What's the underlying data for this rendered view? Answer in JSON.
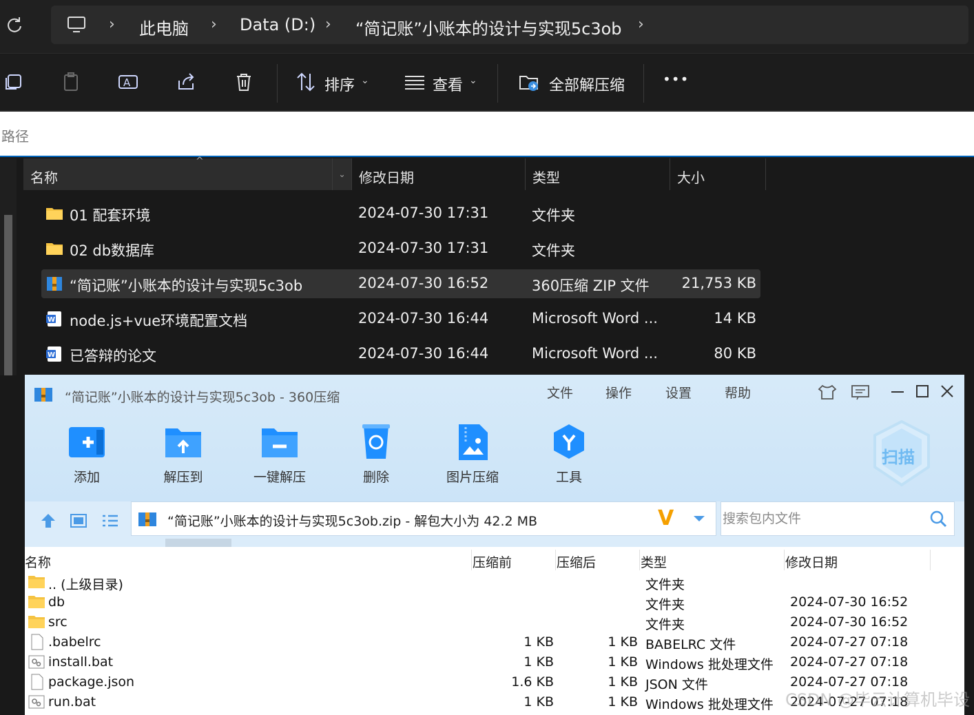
{
  "explorer": {
    "breadcrumbs": [
      "此电脑",
      "Data (D:)",
      "“简记账”小账本的设计与实现5c3ob"
    ],
    "toolbar": {
      "sort_label": "排序",
      "view_label": "查看",
      "extract_all_label": "全部解压缩",
      "more_label": "•••"
    },
    "path_placeholder": "路径",
    "columns": {
      "name": "名称",
      "modified": "修改日期",
      "type": "类型",
      "size": "大小"
    },
    "files": [
      {
        "name": "01 配套环境",
        "modified": "2024-07-30 17:31",
        "type": "文件夹",
        "size": "",
        "icon": "folder-icon"
      },
      {
        "name": "02 db数据库",
        "modified": "2024-07-30 17:31",
        "type": "文件夹",
        "size": "",
        "icon": "folder-icon"
      },
      {
        "name": "“简记账”小账本的设计与实现5c3ob",
        "modified": "2024-07-30 16:52",
        "type": "360压缩 ZIP 文件",
        "size": "21,753 KB",
        "icon": "zip-archive-icon",
        "selected": true
      },
      {
        "name": "node.js+vue环境配置文档",
        "modified": "2024-07-30 16:44",
        "type": "Microsoft Word ...",
        "size": "14 KB",
        "icon": "word-doc-icon"
      },
      {
        "name": "已答辩的论文",
        "modified": "2024-07-30 16:44",
        "type": "Microsoft Word ...",
        "size": "80 KB",
        "icon": "word-doc-icon"
      }
    ]
  },
  "zip": {
    "title": "“简记账”小账本的设计与实现5c3ob - 360压缩",
    "menu": [
      "文件",
      "操作",
      "设置",
      "帮助"
    ],
    "tools": [
      {
        "label": "添加",
        "icon": "add-icon"
      },
      {
        "label": "解压到",
        "icon": "extract-to-icon"
      },
      {
        "label": "一键解压",
        "icon": "one-click-extract-icon"
      },
      {
        "label": "删除",
        "icon": "delete-icon"
      },
      {
        "label": "图片压缩",
        "icon": "image-compress-icon"
      },
      {
        "label": "工具",
        "icon": "tools-icon"
      }
    ],
    "scan_label": "扫描",
    "path_text": "“简记账”小账本的设计与实现5c3ob.zip - 解包大小为 42.2 MB",
    "search_placeholder": "搜索包内文件",
    "columns": {
      "name": "名称",
      "before": "压缩前",
      "after": "压缩后",
      "type": "类型",
      "modified": "修改日期"
    },
    "entries": [
      {
        "name": ".. (上级目录)",
        "before": "",
        "after": "",
        "type": "文件夹",
        "modified": "",
        "icon": "folder-icon"
      },
      {
        "name": "db",
        "before": "",
        "after": "",
        "type": "文件夹",
        "modified": "2024-07-30 16:52",
        "icon": "folder-icon"
      },
      {
        "name": "src",
        "before": "",
        "after": "",
        "type": "文件夹",
        "modified": "2024-07-30 16:52",
        "icon": "folder-icon"
      },
      {
        "name": ".babelrc",
        "before": "1 KB",
        "after": "1 KB",
        "type": "BABELRC 文件",
        "modified": "2024-07-27 07:18",
        "icon": "file-icon"
      },
      {
        "name": "install.bat",
        "before": "1 KB",
        "after": "1 KB",
        "type": "Windows 批处理文件",
        "modified": "2024-07-27 07:18",
        "icon": "batch-file-icon"
      },
      {
        "name": "package.json",
        "before": "1.6 KB",
        "after": "1 KB",
        "type": "JSON 文件",
        "modified": "2024-07-27 07:18",
        "icon": "file-icon"
      },
      {
        "name": "run.bat",
        "before": "1 KB",
        "after": "1 KB",
        "type": "Windows 批处理文件",
        "modified": "2024-07-27 07:18",
        "icon": "batch-file-icon"
      }
    ]
  },
  "watermark": "CSDN @毕云计算机毕设"
}
